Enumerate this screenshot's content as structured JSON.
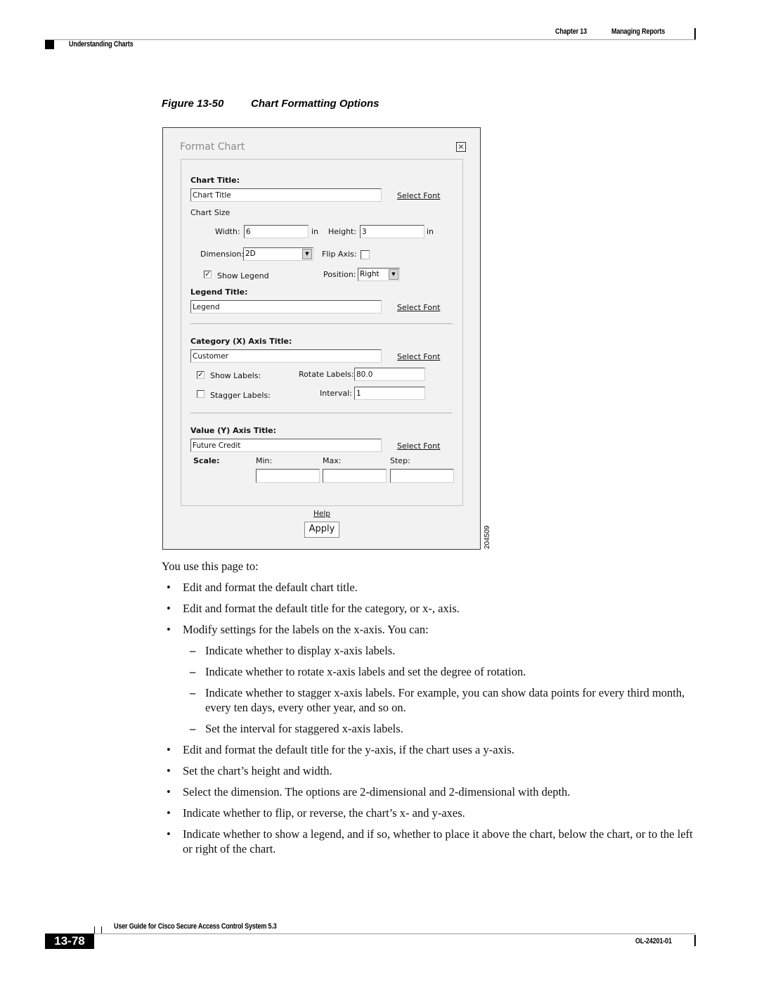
{
  "header": {
    "chapter": "Chapter 13",
    "chapter_title": "Managing Reports",
    "section": "Understanding Charts"
  },
  "figure": {
    "number": "Figure 13-50",
    "title": "Chart Formatting Options",
    "id": "204509"
  },
  "dialog": {
    "title": "Format Chart",
    "close_icon": "close-icon",
    "chart_title": {
      "label": "Chart Title:",
      "value": "Chart Title",
      "select_font": "Select Font"
    },
    "chart_size": {
      "label": "Chart Size",
      "width_label": "Width:",
      "width_value": "6",
      "width_unit": "in",
      "height_label": "Height:",
      "height_value": "3",
      "height_unit": "in"
    },
    "dimension": {
      "label": "Dimension:",
      "value": "2D"
    },
    "flip_axis": {
      "label": "Flip Axis:",
      "checked": false
    },
    "show_legend": {
      "label": "Show Legend",
      "checked": true
    },
    "position": {
      "label": "Position:",
      "value": "Right"
    },
    "legend_title": {
      "label": "Legend Title:",
      "value": "Legend",
      "select_font": "Select Font"
    },
    "x_axis": {
      "label": "Category (X) Axis Title:",
      "value": "Customer",
      "select_font": "Select Font",
      "show_labels_label": "Show Labels:",
      "show_labels_checked": true,
      "rotate_label": "Rotate Labels:",
      "rotate_value": "80.0",
      "stagger_label": "Stagger Labels:",
      "stagger_checked": false,
      "interval_label": "Interval:",
      "interval_value": "1"
    },
    "y_axis": {
      "label": "Value (Y) Axis Title:",
      "value": "Future Credit",
      "select_font": "Select Font",
      "scale_label": "Scale:",
      "min_label": "Min:",
      "min_value": "",
      "max_label": "Max:",
      "max_value": "",
      "step_label": "Step:",
      "step_value": ""
    },
    "help_link": "Help",
    "apply_button": "Apply"
  },
  "body": {
    "intro": "You use this page to:",
    "bullets": [
      "Edit and format the default chart title.",
      "Edit and format the default title for the category, or x-, axis.",
      "Modify settings for the labels on the x-axis. You can:"
    ],
    "sub_bullets": [
      "Indicate whether to display x-axis labels.",
      "Indicate whether to rotate x-axis labels and set the degree of rotation.",
      "Indicate whether to stagger x-axis labels. For example, you can show data points for every third month, every ten days, every other year, and so on.",
      "Set the interval for staggered x-axis labels."
    ],
    "bullets_after": [
      "Edit and format the default title for the y-axis, if the chart uses a y-axis.",
      "Set the chart’s height and width.",
      "Select the dimension. The options are 2-dimensional and 2-dimensional with depth.",
      "Indicate whether to flip, or reverse, the chart’s x- and y-axes.",
      "Indicate whether to show a legend, and if so, whether to place it above the chart, below the chart, or to the left or right of the chart."
    ]
  },
  "footer": {
    "guide_title": "User Guide for Cisco Secure Access Control System 5.3",
    "page_number": "13-78",
    "doc_id": "OL-24201-01"
  }
}
